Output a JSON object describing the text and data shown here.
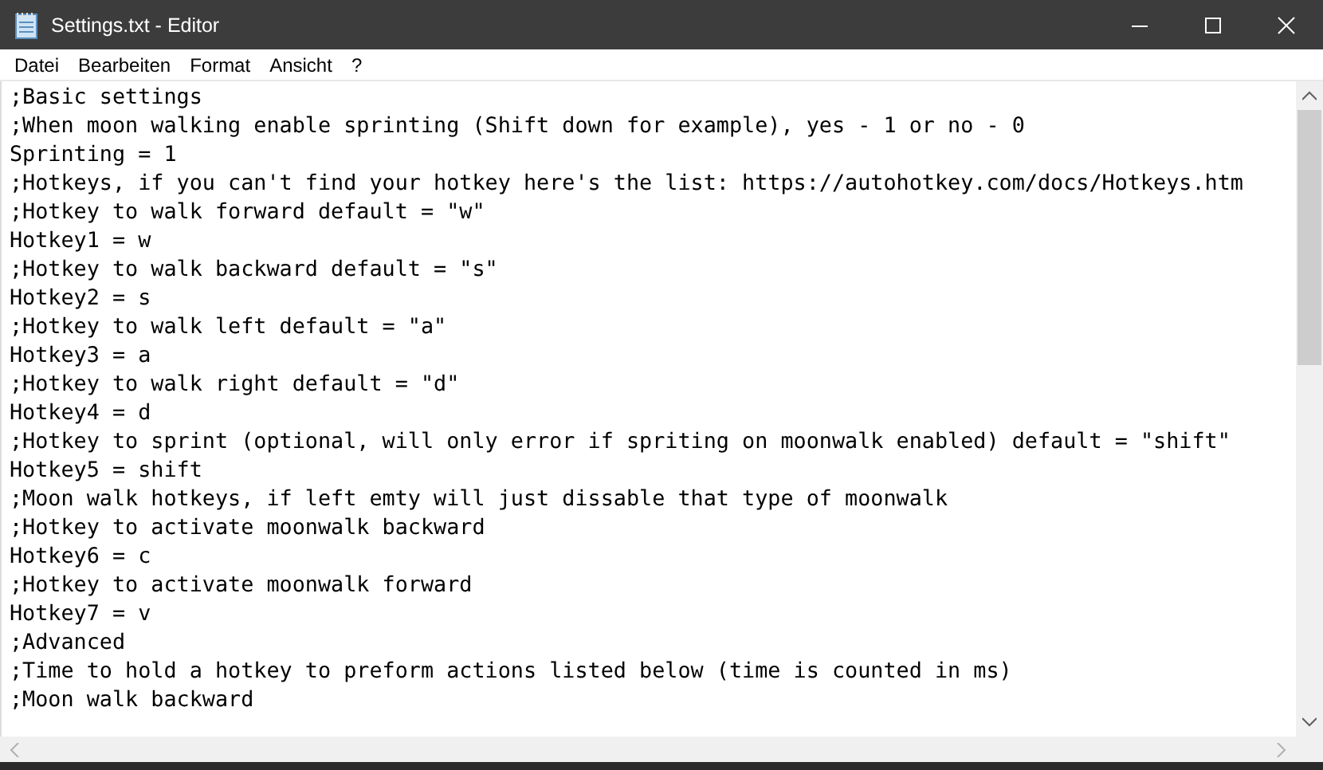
{
  "window": {
    "title": "Settings.txt - Editor"
  },
  "menu": [
    "Datei",
    "Bearbeiten",
    "Format",
    "Ansicht",
    "?"
  ],
  "lines": [
    ";Basic settings",
    ";When moon walking enable sprinting (Shift down for example), yes - 1 or no - 0",
    "Sprinting = 1",
    ";Hotkeys, if you can't find your hotkey here's the list: https://autohotkey.com/docs/Hotkeys.htm",
    ";Hotkey to walk forward default = \"w\"",
    "Hotkey1 = w",
    ";Hotkey to walk backward default = \"s\"",
    "Hotkey2 = s",
    ";Hotkey to walk left default = \"a\"",
    "Hotkey3 = a",
    ";Hotkey to walk right default = \"d\"",
    "Hotkey4 = d",
    ";Hotkey to sprint (optional, will only error if spriting on moonwalk enabled) default = \"shift\"",
    "Hotkey5 = shift",
    ";Moon walk hotkeys, if left emty will just dissable that type of moonwalk",
    ";Hotkey to activate moonwalk backward",
    "Hotkey6 = c",
    ";Hotkey to activate moonwalk forward",
    "Hotkey7 = v",
    ";Advanced",
    ";Time to hold a hotkey to preform actions listed below (time is counted in ms)",
    ";Moon walk backward"
  ]
}
